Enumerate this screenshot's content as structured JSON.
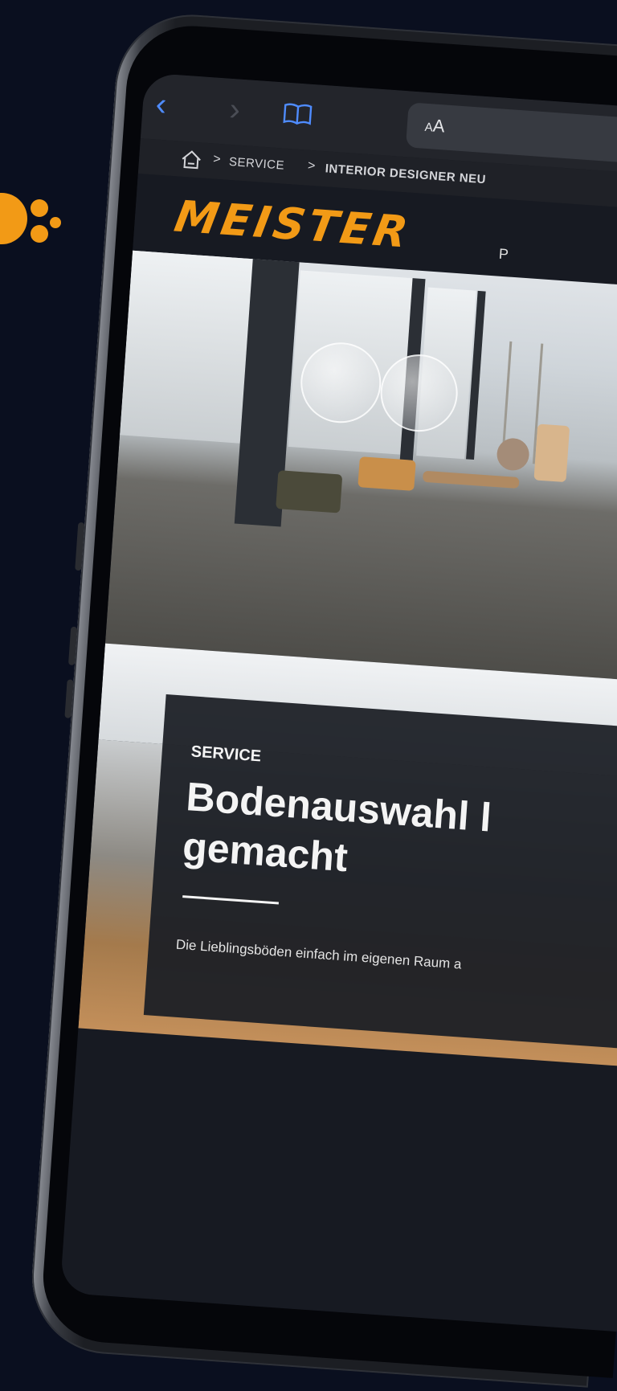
{
  "browser": {
    "back_glyph": "‹",
    "forward_glyph": "›",
    "bookmarks_icon": "book-open-icon",
    "reader_label_small": "A",
    "reader_label_large": "A"
  },
  "breadcrumb": {
    "home_icon": "home-icon",
    "separator": ">",
    "items": [
      "SERVICE",
      "INTERIOR DESIGNER NEU"
    ]
  },
  "site": {
    "logo_text": "MEISTER",
    "nav_partial": "P"
  },
  "card": {
    "eyebrow": "SERVICE",
    "title": "Bodenauswahl l",
    "title_line2": "gemacht",
    "description": "Die Lieblingsböden einfach im eigenen Raum a"
  },
  "colors": {
    "brand": "#f29a16",
    "link_blue": "#4f8cff",
    "background": "#0a0f1f"
  }
}
